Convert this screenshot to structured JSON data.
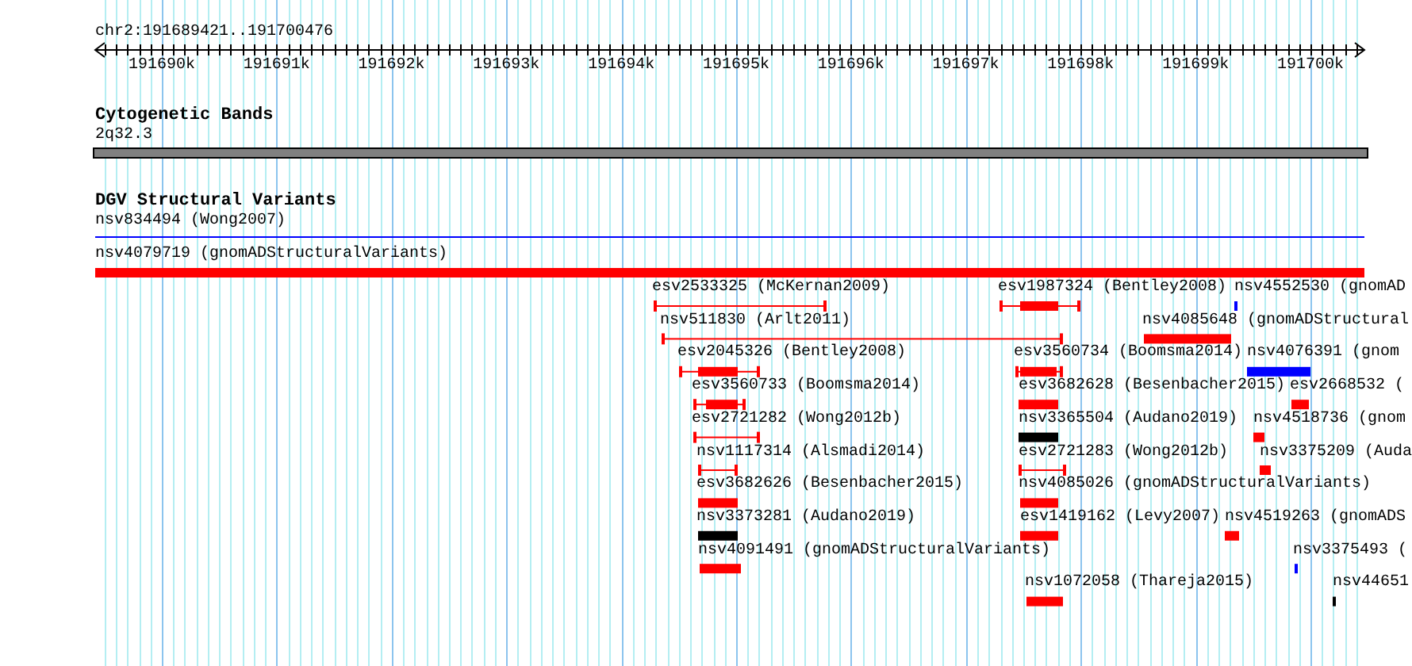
{
  "ruler": {
    "location": "chr2:191689421..191700476",
    "ticks": [
      "191690k",
      "191691k",
      "191692k",
      "191693k",
      "191694k",
      "191695k",
      "191696k",
      "191697k",
      "191698k",
      "191699k",
      "191700k"
    ]
  },
  "cytogenetic_bands": {
    "title": "Cytogenetic Bands",
    "band": {
      "label": "2q32.3",
      "color": "#808080"
    }
  },
  "structural_variants": {
    "title": "DGV Structural Variants",
    "features": [
      {
        "label": "nsv834494 (Wong2007)",
        "kind": "line",
        "color": "#0000ff"
      },
      {
        "label": "nsv4079719 (gnomADStructuralVariants)",
        "kind": "block",
        "color": "#ff0000"
      },
      {
        "label": "esv2533325 (McKernan2009)",
        "kind": "span",
        "color": "#ff0000"
      },
      {
        "label": "esv1987324 (Bentley2008)",
        "kind": "span-block",
        "color": "#ff0000"
      },
      {
        "label": "nsv4552530 (gnomAD",
        "kind": "block",
        "color": "#0000ff"
      },
      {
        "label": "nsv511830 (Arlt2011)",
        "kind": "span",
        "color": "#ff0000"
      },
      {
        "label": "nsv4085648 (gnomADStructural",
        "kind": "block",
        "color": "#ff0000"
      },
      {
        "label": "esv2045326 (Bentley2008)",
        "kind": "span-block",
        "color": "#ff0000"
      },
      {
        "label": "esv3560734 (Boomsma2014)",
        "kind": "span-block",
        "color": "#ff0000"
      },
      {
        "label": "nsv4076391 (gnom",
        "kind": "block",
        "color": "#0000ff"
      },
      {
        "label": "esv3560733 (Boomsma2014)",
        "kind": "span-block",
        "color": "#ff0000"
      },
      {
        "label": "esv3682628 (Besenbacher2015)",
        "kind": "block",
        "color": "#ff0000"
      },
      {
        "label": "esv2668532 (",
        "kind": "block",
        "color": "#ff0000"
      },
      {
        "label": "esv2721282 (Wong2012b)",
        "kind": "span",
        "color": "#ff0000"
      },
      {
        "label": "nsv3365504 (Audano2019)",
        "kind": "block",
        "color": "#000000"
      },
      {
        "label": "nsv4518736 (gnom",
        "kind": "block",
        "color": "#ff0000"
      },
      {
        "label": "nsv1117314 (Alsmadi2014)",
        "kind": "span",
        "color": "#ff0000"
      },
      {
        "label": "esv2721283 (Wong2012b)",
        "kind": "span",
        "color": "#ff0000"
      },
      {
        "label": "nsv3375209 (Auda",
        "kind": "block",
        "color": "#ff0000"
      },
      {
        "label": "esv3682626 (Besenbacher2015)",
        "kind": "block",
        "color": "#ff0000"
      },
      {
        "label": "nsv4085026 (gnomADStructuralVariants)",
        "kind": "block",
        "color": "#ff0000"
      },
      {
        "label": "nsv3373281 (Audano2019)",
        "kind": "block",
        "color": "#000000"
      },
      {
        "label": "esv1419162 (Levy2007)",
        "kind": "block",
        "color": "#ff0000"
      },
      {
        "label": "nsv4519263 (gnomADS",
        "kind": "block",
        "color": "#ff0000"
      },
      {
        "label": "nsv4091491 (gnomADStructuralVariants)",
        "kind": "block",
        "color": "#ff0000"
      },
      {
        "label": "nsv3375493 (",
        "kind": "block",
        "color": "#0000ff"
      },
      {
        "label": "nsv1072058 (Thareja2015)",
        "kind": "block",
        "color": "#ff0000"
      },
      {
        "label": "nsv44651",
        "kind": "block",
        "color": "#000000"
      }
    ]
  }
}
